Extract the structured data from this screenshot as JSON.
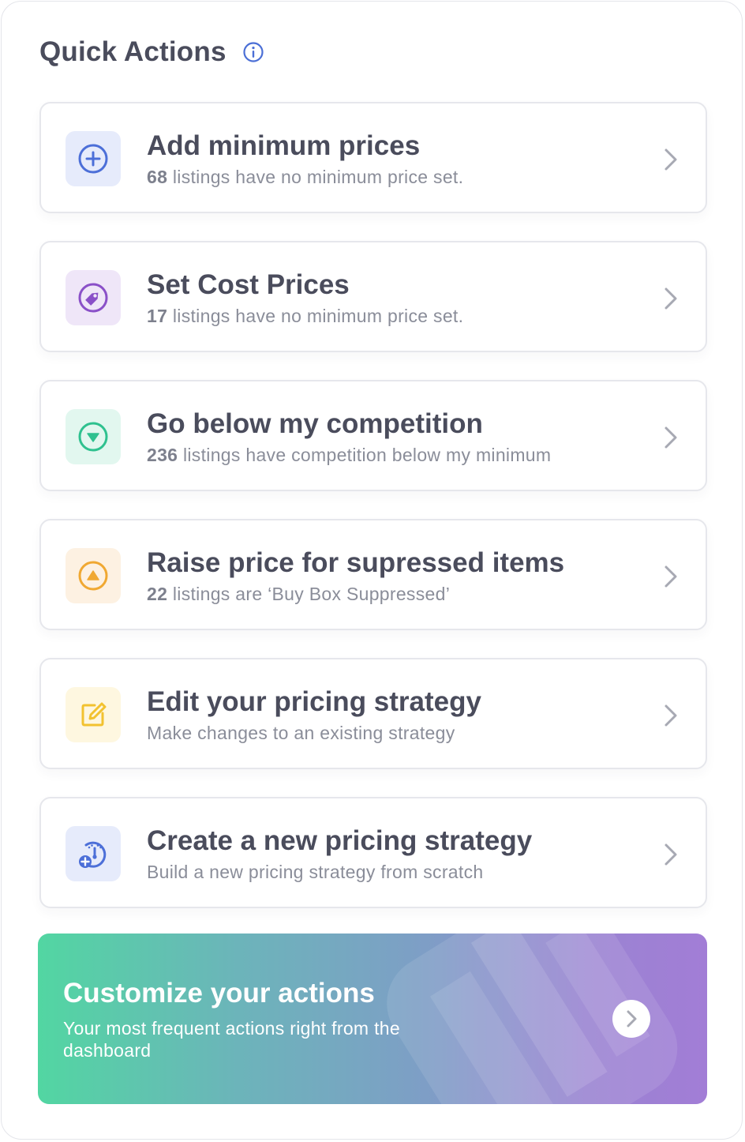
{
  "header": {
    "title": "Quick Actions",
    "info_icon": "info-icon",
    "accent": "#4b6fd6"
  },
  "actions": [
    {
      "title": "Add minimum prices",
      "count": "68",
      "subtitle": " listings have no minimum price set.",
      "icon": "plus-circle-icon",
      "icon_color": "#4c6fd8",
      "icon_bg": "#e6ebfb"
    },
    {
      "title": "Set Cost Prices",
      "count": "17",
      "subtitle": " listings have no minimum price set.",
      "icon": "price-tag-icon",
      "icon_color": "#8a50c8",
      "icon_bg": "#efe6f8"
    },
    {
      "title": "Go below my competition",
      "count": "236",
      "subtitle": " listings have competition below my minimum",
      "icon": "arrow-down-circle-icon",
      "icon_color": "#2fc18f",
      "icon_bg": "#e2f7ef"
    },
    {
      "title": "Raise price for supressed items",
      "count": "22",
      "subtitle": " listings are ‘Buy Box Suppressed’",
      "icon": "arrow-up-circle-icon",
      "icon_color": "#f0a832",
      "icon_bg": "#fdf1e2"
    },
    {
      "title": "Edit your pricing strategy",
      "count": "",
      "subtitle": "Make changes to an existing strategy",
      "icon": "edit-icon",
      "icon_color": "#f2c230",
      "icon_bg": "#fef7e0"
    },
    {
      "title": "Create a new pricing strategy",
      "count": "",
      "subtitle": "Build a new pricing strategy from scratch",
      "icon": "new-strategy-icon",
      "icon_color": "#4c6fd8",
      "icon_bg": "#e6ebfb"
    }
  ],
  "banner": {
    "title": "Customize your actions",
    "subtitle": "Your most frequent actions right from the dashboard",
    "button_icon": "chevron-right-icon"
  },
  "colors": {
    "text_dark": "#4a4c5c",
    "text_muted": "#8a8d99",
    "border": "#e6e7ec"
  }
}
